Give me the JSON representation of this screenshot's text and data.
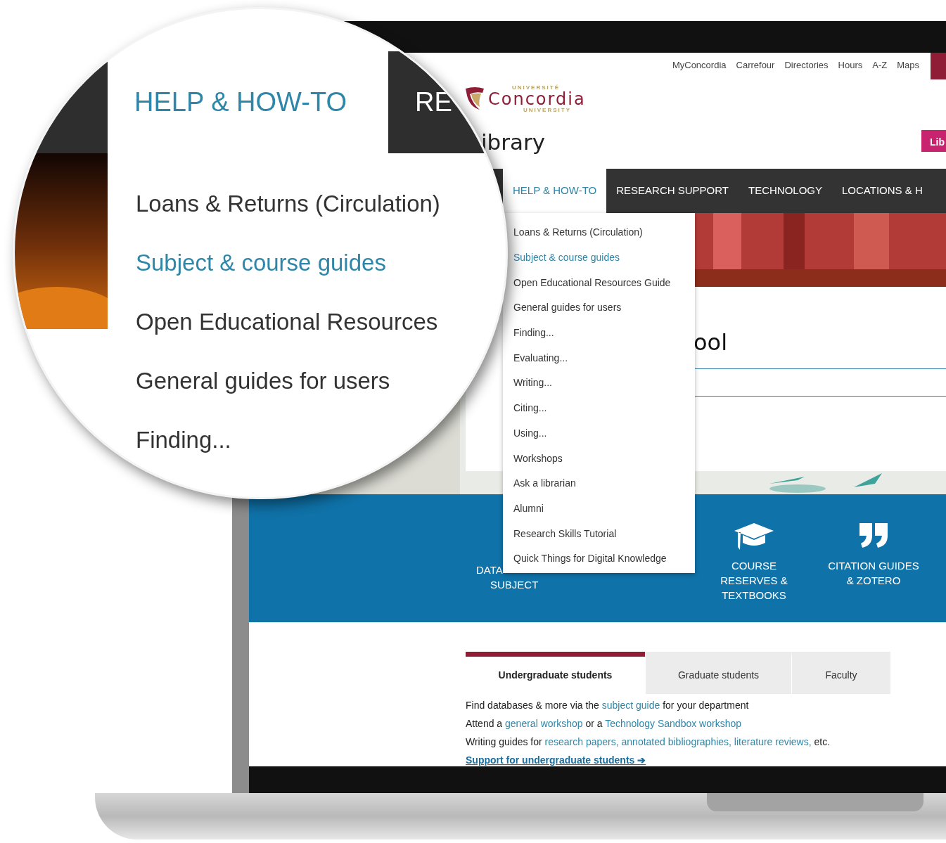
{
  "top_links": [
    "MyConcordia",
    "Carrefour",
    "Directories",
    "Hours",
    "A-Z",
    "Maps"
  ],
  "logo": {
    "top": "UNIVERSITÉ",
    "name": "Concordia",
    "bottom": "UNIVERSITY"
  },
  "site_title": "ibrary",
  "header_button": "Lib",
  "nav": [
    {
      "label": "HELP & HOW-TO",
      "selected": true
    },
    {
      "label": "RESEARCH SUPPORT",
      "selected": false
    },
    {
      "label": "TECHNOLOGY",
      "selected": false
    },
    {
      "label": "LOCATIONS & H",
      "selected": false
    }
  ],
  "dropdown": [
    {
      "label": "Loans & Returns (Circulation)",
      "selected": false
    },
    {
      "label": "Subject & course guides",
      "selected": true
    },
    {
      "label": "Open Educational Resources Guide",
      "selected": false
    },
    {
      "label": "General guides for users",
      "selected": false
    },
    {
      "label": "Finding...",
      "selected": false
    },
    {
      "label": "Evaluating...",
      "selected": false
    },
    {
      "label": "Writing...",
      "selected": false
    },
    {
      "label": "Citing...",
      "selected": false
    },
    {
      "label": "Using...",
      "selected": false
    },
    {
      "label": "Workshops",
      "selected": false
    },
    {
      "label": "Ask a librarian",
      "selected": false
    },
    {
      "label": "Alumni",
      "selected": false
    },
    {
      "label": "Research Skills Tutorial",
      "selected": false
    },
    {
      "label": "Quick Things for Digital Knowledge",
      "selected": false
    }
  ],
  "heading": "ool",
  "quick_links": [
    {
      "kind": "hidden",
      "lines": [
        "DATA",
        "SUBJECT"
      ]
    },
    {
      "kind": "cap",
      "lines": [
        "COURSE",
        "RESERVES &",
        "TEXTBOOKS"
      ]
    },
    {
      "kind": "quote",
      "lines": [
        "CITATION GUIDES",
        "& ZOTERO"
      ]
    }
  ],
  "audience_tabs": [
    {
      "label": "Undergraduate students",
      "selected": true
    },
    {
      "label": "Graduate students",
      "selected": false
    },
    {
      "label": "Faculty",
      "selected": false
    }
  ],
  "paragraphs": [
    [
      {
        "text": "Find databases & more via the "
      },
      {
        "text": "subject guide",
        "link": true
      },
      {
        "text": " for your department"
      }
    ],
    [
      {
        "text": "Attend a "
      },
      {
        "text": "general workshop",
        "link": true
      },
      {
        "text": " or a "
      },
      {
        "text": "Technology Sandbox workshop",
        "link": true
      }
    ],
    [
      {
        "text": "Writing guides for "
      },
      {
        "text": "research papers, annotated bibliographies, literature reviews,",
        "link": true
      },
      {
        "text": " etc."
      }
    ]
  ],
  "support_link": "Support for undergraduate students ➔",
  "magnifier": {
    "nav": [
      {
        "label": "HELP & HOW-TO",
        "selected": true
      },
      {
        "label": "RE",
        "selected": false
      }
    ],
    "items": [
      {
        "label": "Loans & Returns (Circulation)",
        "selected": false
      },
      {
        "label": "Subject & course guides",
        "selected": true
      },
      {
        "label": "Open Educational Resources",
        "selected": false
      },
      {
        "label": "General guides for users",
        "selected": false
      },
      {
        "label": "Finding...",
        "selected": false
      }
    ]
  }
}
